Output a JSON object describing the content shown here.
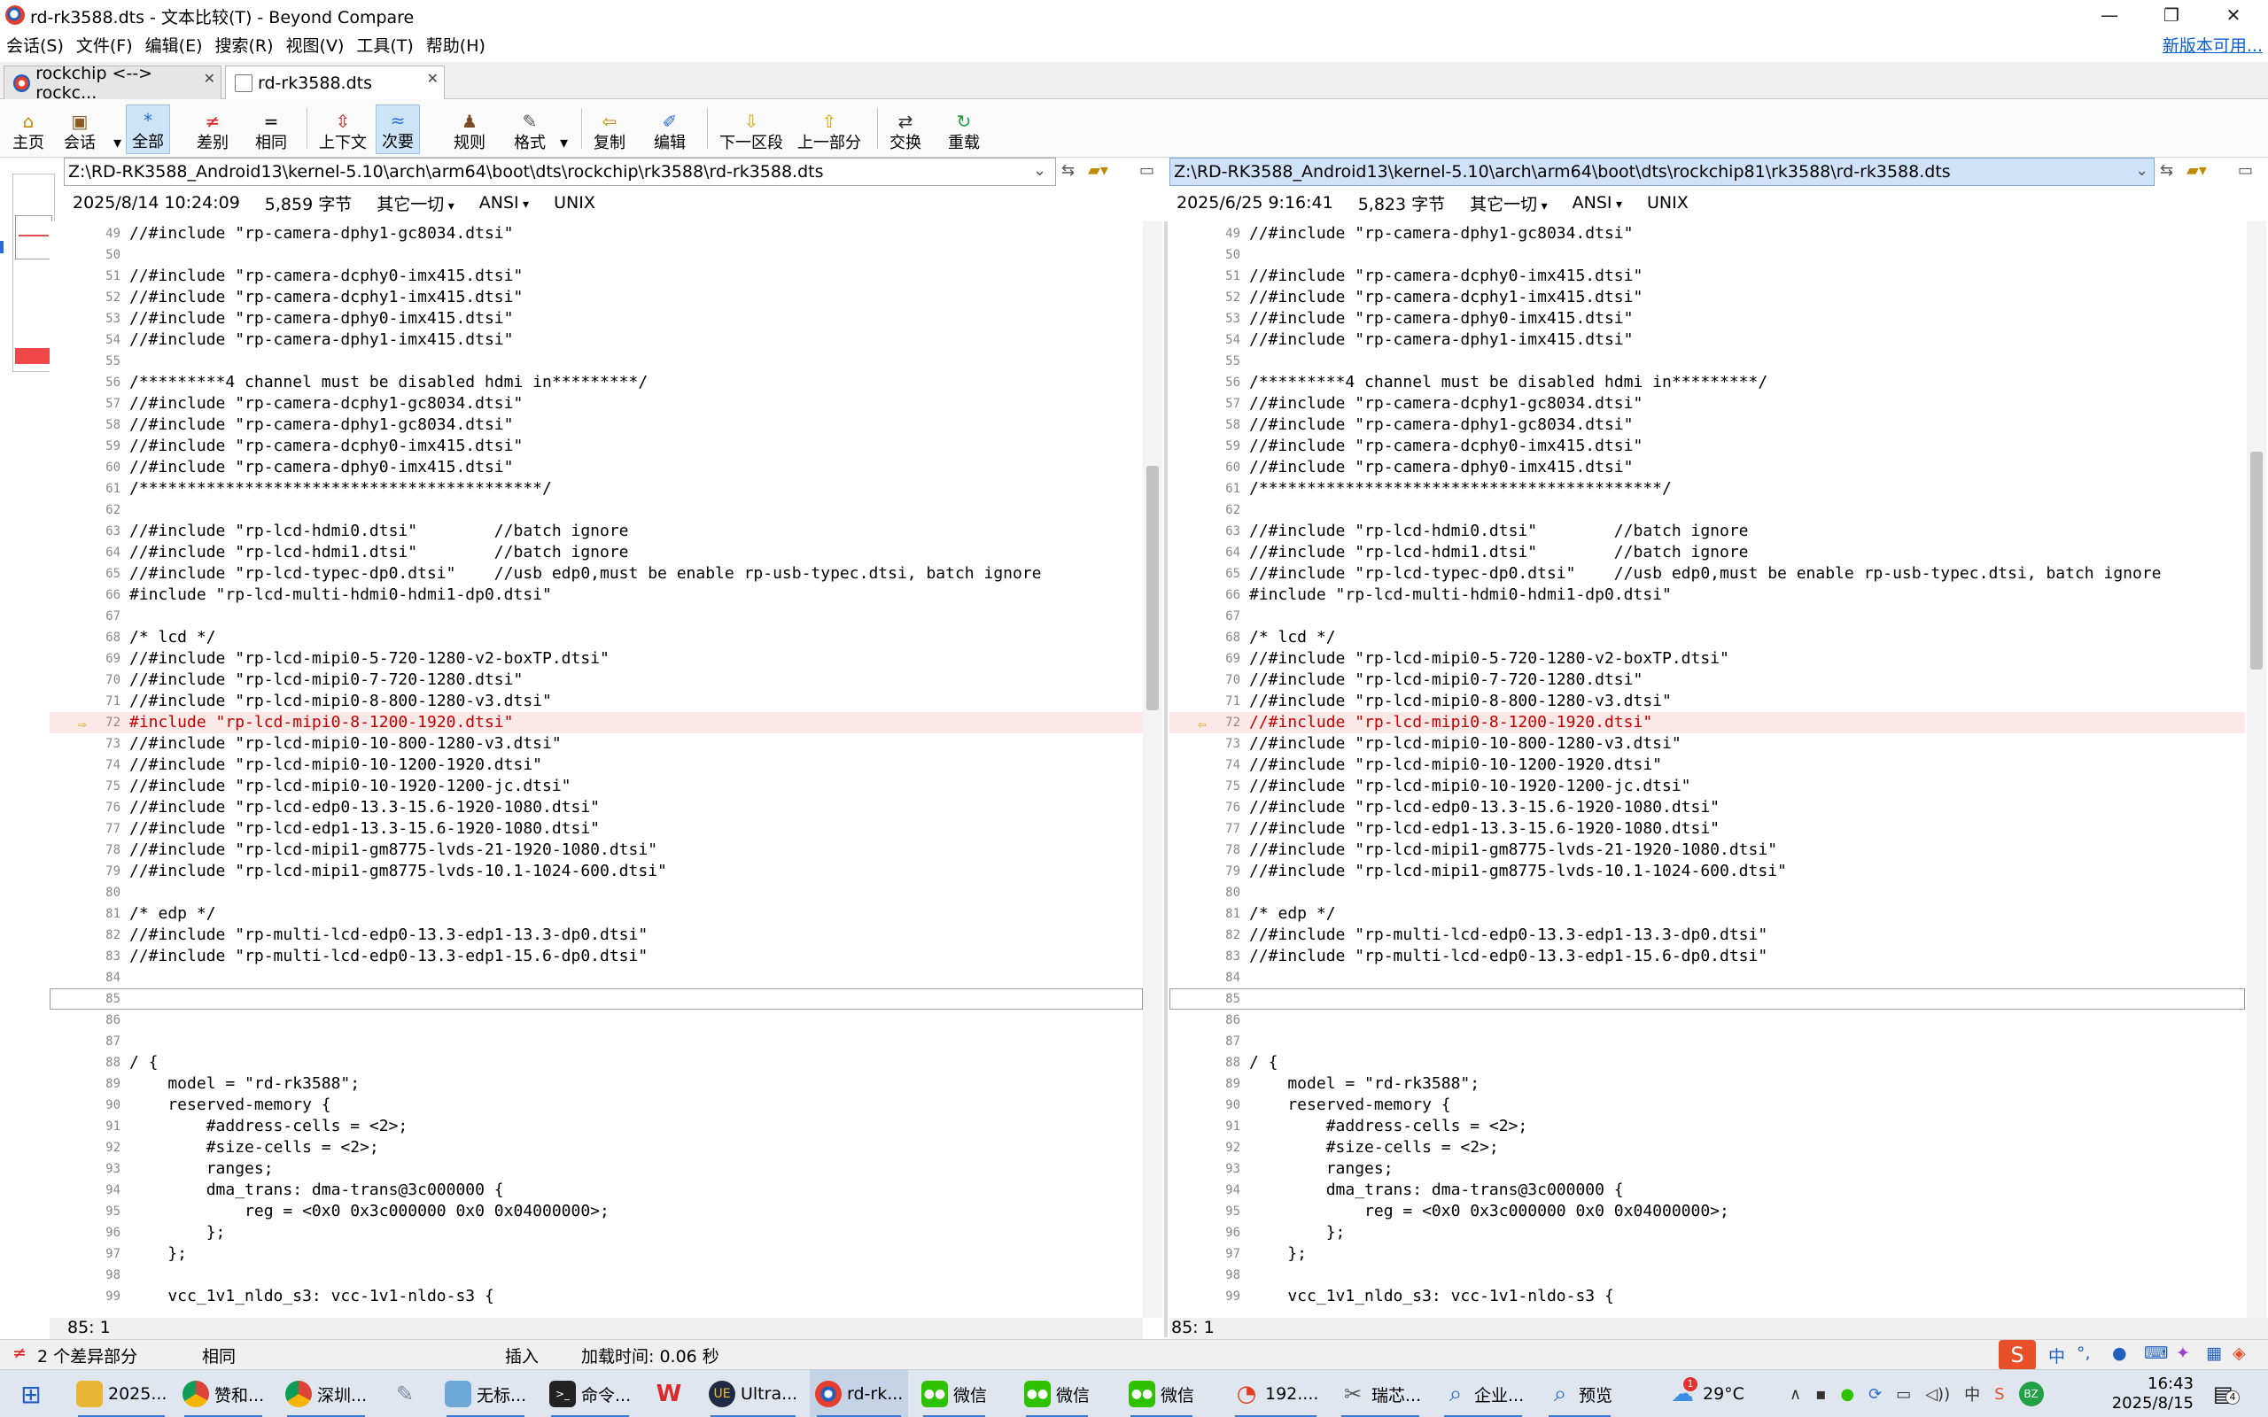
{
  "window": {
    "title": "rd-rk3588.dts - 文本比较(T) - Beyond Compare",
    "minimize": "—",
    "restore": "❐",
    "close": "✕"
  },
  "menu": {
    "items": [
      "会话(S)",
      "文件(F)",
      "编辑(E)",
      "搜索(R)",
      "视图(V)",
      "工具(T)",
      "帮助(H)"
    ],
    "update_link": "新版本可用..."
  },
  "tabs": [
    {
      "label": "rockchip <--> rockc...",
      "close": "✕"
    },
    {
      "label": "rd-rk3588.dts",
      "close": "✕"
    }
  ],
  "toolbar": {
    "home": "主页",
    "session": "会话",
    "all": "全部",
    "diffs": "差别",
    "same": "相同",
    "context": "上下文",
    "minor": "次要",
    "rules": "规则",
    "format": "格式",
    "copy": "复制",
    "edit": "编辑",
    "next_section": "下一区段",
    "prev_section": "上一部分",
    "swap": "交换",
    "reload": "重载"
  },
  "left": {
    "path": "Z:\\RD-RK3588_Android13\\kernel-5.10\\arch\\arm64\\boot\\dts\\rockchip\\rk3588\\rd-rk3588.dts",
    "date": "2025/8/14 10:24:09",
    "size": "5,859 字节",
    "filter": "其它一切",
    "encoding": "ANSI",
    "eol": "UNIX",
    "position": "85: 1"
  },
  "right": {
    "path": "Z:\\RD-RK3588_Android13\\kernel-5.10\\arch\\arm64\\boot\\dts\\rockchip81\\rk3588\\rd-rk3588.dts",
    "date": "2025/6/25 9:16:41",
    "size": "5,823 字节",
    "filter": "其它一切",
    "encoding": "ANSI",
    "eol": "UNIX",
    "position": "85: 1"
  },
  "lines_left": [
    {
      "n": "49",
      "t": "//#include \"rp-camera-dphy1-gc8034.dtsi\""
    },
    {
      "n": "50",
      "t": ""
    },
    {
      "n": "51",
      "t": "//#include \"rp-camera-dcphy0-imx415.dtsi\""
    },
    {
      "n": "52",
      "t": "//#include \"rp-camera-dcphy1-imx415.dtsi\""
    },
    {
      "n": "53",
      "t": "//#include \"rp-camera-dphy0-imx415.dtsi\""
    },
    {
      "n": "54",
      "t": "//#include \"rp-camera-dphy1-imx415.dtsi\""
    },
    {
      "n": "55",
      "t": ""
    },
    {
      "n": "56",
      "t": "/*********4 channel must be disabled hdmi in*********/"
    },
    {
      "n": "57",
      "t": "//#include \"rp-camera-dcphy1-gc8034.dtsi\""
    },
    {
      "n": "58",
      "t": "//#include \"rp-camera-dphy1-gc8034.dtsi\""
    },
    {
      "n": "59",
      "t": "//#include \"rp-camera-dcphy0-imx415.dtsi\""
    },
    {
      "n": "60",
      "t": "//#include \"rp-camera-dphy0-imx415.dtsi\""
    },
    {
      "n": "61",
      "t": "/******************************************/"
    },
    {
      "n": "62",
      "t": ""
    },
    {
      "n": "63",
      "t": "//#include \"rp-lcd-hdmi0.dtsi\"        //batch ignore"
    },
    {
      "n": "64",
      "t": "//#include \"rp-lcd-hdmi1.dtsi\"        //batch ignore"
    },
    {
      "n": "65",
      "t": "//#include \"rp-lcd-typec-dp0.dtsi\"    //usb edp0,must be enable rp-usb-typec.dtsi, batch ignore"
    },
    {
      "n": "66",
      "t": "#include \"rp-lcd-multi-hdmi0-hdmi1-dp0.dtsi\""
    },
    {
      "n": "67",
      "t": ""
    },
    {
      "n": "68",
      "t": "/* lcd */"
    },
    {
      "n": "69",
      "t": "//#include \"rp-lcd-mipi0-5-720-1280-v2-boxTP.dtsi\""
    },
    {
      "n": "70",
      "t": "//#include \"rp-lcd-mipi0-7-720-1280.dtsi\""
    },
    {
      "n": "71",
      "t": "//#include \"rp-lcd-mipi0-8-800-1280-v3.dtsi\""
    },
    {
      "n": "72",
      "t": "#include \"rp-lcd-mipi0-8-1200-1920.dtsi\"",
      "diff": true
    },
    {
      "n": "73",
      "t": "//#include \"rp-lcd-mipi0-10-800-1280-v3.dtsi\""
    },
    {
      "n": "74",
      "t": "//#include \"rp-lcd-mipi0-10-1200-1920.dtsi\""
    },
    {
      "n": "75",
      "t": "//#include \"rp-lcd-mipi0-10-1920-1200-jc.dtsi\""
    },
    {
      "n": "76",
      "t": "//#include \"rp-lcd-edp0-13.3-15.6-1920-1080.dtsi\""
    },
    {
      "n": "77",
      "t": "//#include \"rp-lcd-edp1-13.3-15.6-1920-1080.dtsi\""
    },
    {
      "n": "78",
      "t": "//#include \"rp-lcd-mipi1-gm8775-lvds-21-1920-1080.dtsi\""
    },
    {
      "n": "79",
      "t": "//#include \"rp-lcd-mipi1-gm8775-lvds-10.1-1024-600.dtsi\""
    },
    {
      "n": "80",
      "t": ""
    },
    {
      "n": "81",
      "t": "/* edp */"
    },
    {
      "n": "82",
      "t": "//#include \"rp-multi-lcd-edp0-13.3-edp1-13.3-dp0.dtsi\""
    },
    {
      "n": "83",
      "t": "//#include \"rp-multi-lcd-edp0-13.3-edp1-15.6-dp0.dtsi\""
    },
    {
      "n": "84",
      "t": ""
    },
    {
      "n": "85",
      "t": "",
      "cursor": true
    },
    {
      "n": "86",
      "t": ""
    },
    {
      "n": "87",
      "t": ""
    },
    {
      "n": "88",
      "t": "/ {"
    },
    {
      "n": "89",
      "t": "    model = \"rd-rk3588\";"
    },
    {
      "n": "90",
      "t": "    reserved-memory {"
    },
    {
      "n": "91",
      "t": "        #address-cells = <2>;"
    },
    {
      "n": "92",
      "t": "        #size-cells = <2>;"
    },
    {
      "n": "93",
      "t": "        ranges;"
    },
    {
      "n": "94",
      "t": "        dma_trans: dma-trans@3c000000 {"
    },
    {
      "n": "95",
      "t": "            reg = <0x0 0x3c000000 0x0 0x04000000>;"
    },
    {
      "n": "96",
      "t": "        };"
    },
    {
      "n": "97",
      "t": "    };"
    },
    {
      "n": "98",
      "t": ""
    },
    {
      "n": "99",
      "t": "    vcc_1v1_nldo_s3: vcc-1v1-nldo-s3 {"
    }
  ],
  "lines_right": [
    {
      "n": "49",
      "t": "//#include \"rp-camera-dphy1-gc8034.dtsi\""
    },
    {
      "n": "50",
      "t": ""
    },
    {
      "n": "51",
      "t": "//#include \"rp-camera-dcphy0-imx415.dtsi\""
    },
    {
      "n": "52",
      "t": "//#include \"rp-camera-dcphy1-imx415.dtsi\""
    },
    {
      "n": "53",
      "t": "//#include \"rp-camera-dphy0-imx415.dtsi\""
    },
    {
      "n": "54",
      "t": "//#include \"rp-camera-dphy1-imx415.dtsi\""
    },
    {
      "n": "55",
      "t": ""
    },
    {
      "n": "56",
      "t": "/*********4 channel must be disabled hdmi in*********/"
    },
    {
      "n": "57",
      "t": "//#include \"rp-camera-dcphy1-gc8034.dtsi\""
    },
    {
      "n": "58",
      "t": "//#include \"rp-camera-dphy1-gc8034.dtsi\""
    },
    {
      "n": "59",
      "t": "//#include \"rp-camera-dcphy0-imx415.dtsi\""
    },
    {
      "n": "60",
      "t": "//#include \"rp-camera-dphy0-imx415.dtsi\""
    },
    {
      "n": "61",
      "t": "/******************************************/"
    },
    {
      "n": "62",
      "t": ""
    },
    {
      "n": "63",
      "t": "//#include \"rp-lcd-hdmi0.dtsi\"        //batch ignore"
    },
    {
      "n": "64",
      "t": "//#include \"rp-lcd-hdmi1.dtsi\"        //batch ignore"
    },
    {
      "n": "65",
      "t": "//#include \"rp-lcd-typec-dp0.dtsi\"    //usb edp0,must be enable rp-usb-typec.dtsi, batch ignore"
    },
    {
      "n": "66",
      "t": "#include \"rp-lcd-multi-hdmi0-hdmi1-dp0.dtsi\""
    },
    {
      "n": "67",
      "t": ""
    },
    {
      "n": "68",
      "t": "/* lcd */"
    },
    {
      "n": "69",
      "t": "//#include \"rp-lcd-mipi0-5-720-1280-v2-boxTP.dtsi\""
    },
    {
      "n": "70",
      "t": "//#include \"rp-lcd-mipi0-7-720-1280.dtsi\""
    },
    {
      "n": "71",
      "t": "//#include \"rp-lcd-mipi0-8-800-1280-v3.dtsi\""
    },
    {
      "n": "72",
      "t": "//#include \"rp-lcd-mipi0-8-1200-1920.dtsi\"",
      "diff": true
    },
    {
      "n": "73",
      "t": "//#include \"rp-lcd-mipi0-10-800-1280-v3.dtsi\""
    },
    {
      "n": "74",
      "t": "//#include \"rp-lcd-mipi0-10-1200-1920.dtsi\""
    },
    {
      "n": "75",
      "t": "//#include \"rp-lcd-mipi0-10-1920-1200-jc.dtsi\""
    },
    {
      "n": "76",
      "t": "//#include \"rp-lcd-edp0-13.3-15.6-1920-1080.dtsi\""
    },
    {
      "n": "77",
      "t": "//#include \"rp-lcd-edp1-13.3-15.6-1920-1080.dtsi\""
    },
    {
      "n": "78",
      "t": "//#include \"rp-lcd-mipi1-gm8775-lvds-21-1920-1080.dtsi\""
    },
    {
      "n": "79",
      "t": "//#include \"rp-lcd-mipi1-gm8775-lvds-10.1-1024-600.dtsi\""
    },
    {
      "n": "80",
      "t": ""
    },
    {
      "n": "81",
      "t": "/* edp */"
    },
    {
      "n": "82",
      "t": "//#include \"rp-multi-lcd-edp0-13.3-edp1-13.3-dp0.dtsi\""
    },
    {
      "n": "83",
      "t": "//#include \"rp-multi-lcd-edp0-13.3-edp1-15.6-dp0.dtsi\""
    },
    {
      "n": "84",
      "t": ""
    },
    {
      "n": "85",
      "t": "",
      "cursor": true
    },
    {
      "n": "86",
      "t": ""
    },
    {
      "n": "87",
      "t": ""
    },
    {
      "n": "88",
      "t": "/ {"
    },
    {
      "n": "89",
      "t": "    model = \"rd-rk3588\";"
    },
    {
      "n": "90",
      "t": "    reserved-memory {"
    },
    {
      "n": "91",
      "t": "        #address-cells = <2>;"
    },
    {
      "n": "92",
      "t": "        #size-cells = <2>;"
    },
    {
      "n": "93",
      "t": "        ranges;"
    },
    {
      "n": "94",
      "t": "        dma_trans: dma-trans@3c000000 {"
    },
    {
      "n": "95",
      "t": "            reg = <0x0 0x3c000000 0x0 0x04000000>;"
    },
    {
      "n": "96",
      "t": "        };"
    },
    {
      "n": "97",
      "t": "    };"
    },
    {
      "n": "98",
      "t": ""
    },
    {
      "n": "99",
      "t": "    vcc_1v1_nldo_s3: vcc-1v1-nldo-s3 {"
    }
  ],
  "status": {
    "diff_count": "2 个差异部分",
    "same": "相同",
    "insert": "插入",
    "load_time": "加载时间: 0.06 秒"
  },
  "ime": {
    "lang": "中",
    "punct": "°,"
  },
  "taskbar": {
    "apps": [
      "2025...",
      "赞和...",
      "深圳...",
      "无标...",
      "命令...",
      "Ultra...",
      "rd-rk...",
      "微信",
      "微信",
      "微信",
      "192....",
      "瑞芯...",
      "企业...",
      "预览"
    ],
    "weather": "29°C",
    "time": "16:43",
    "date": "2025/8/15",
    "notif_count": "4",
    "weather_badge": "1"
  },
  "colors": {
    "diff_bg": "#fde8e8",
    "diff_text": "#c00000",
    "accent": "#3b78d8"
  }
}
